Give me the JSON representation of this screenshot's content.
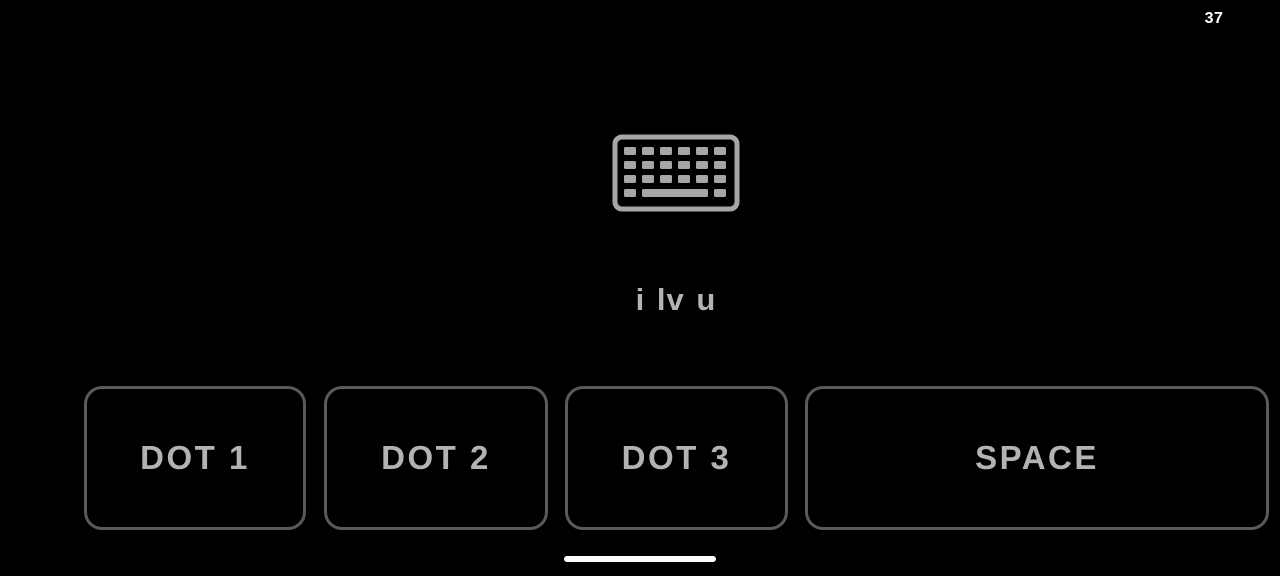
{
  "status_bar": {
    "time": "37"
  },
  "center": {
    "icon": "keyboard-icon",
    "typed_text": "i lv u"
  },
  "keys": {
    "dot1_label": "DOT 1",
    "dot2_label": "DOT 2",
    "dot3_label": "DOT 3",
    "space_label": "SPACE"
  },
  "colors": {
    "background": "#000000",
    "text": "#b3b3b3",
    "button_border": "#5a5a5a",
    "status_text": "#ffffff"
  }
}
